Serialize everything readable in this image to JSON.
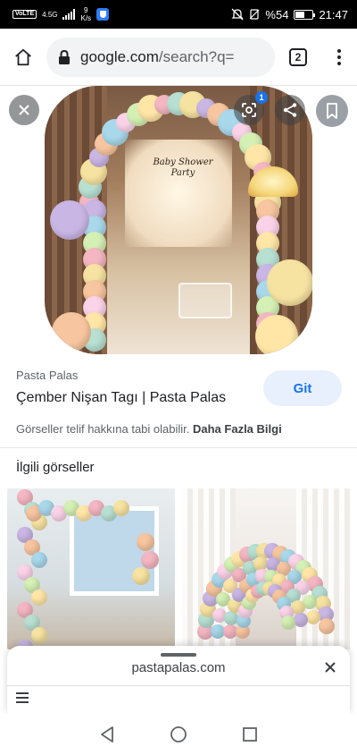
{
  "status_bar": {
    "network": "VoLTE",
    "signal": "4.5G",
    "speed_value": "9",
    "speed_unit": "K/s",
    "battery_text": "%54",
    "time": "21:47",
    "battery_level": 0.54
  },
  "toolbar": {
    "url_main": "google.com",
    "url_path": "/search?q=",
    "tab_count": "2"
  },
  "preview": {
    "sign_line1": "Baby Shower",
    "sign_line2": "Party",
    "lens_badge": "1"
  },
  "result": {
    "source": "Pasta Palas",
    "title": "Çember Nişan Tagı | Pasta Palas",
    "go_label": "Git",
    "copyright_text": "Görseller telif hakkına tabi olabilir.",
    "more_info_link": "Daha Fazla Bilgi"
  },
  "related": {
    "heading": "İlgili görseller"
  },
  "bottom_sheet": {
    "url": "pastapalas.com"
  },
  "icons": {
    "home": "home-icon",
    "lock": "lock-icon",
    "more": "more-vert-icon",
    "close": "close-icon",
    "lens": "lens-icon",
    "share": "share-icon",
    "bookmark": "bookmark-icon",
    "back": "back-icon",
    "nav_home": "circle-home-icon",
    "recents": "recents-icon",
    "menu": "hamburger-icon"
  },
  "colors": {
    "accent": "#1a73e8",
    "go_button_bg": "#e8f0fe",
    "status_bar": "#000000"
  }
}
